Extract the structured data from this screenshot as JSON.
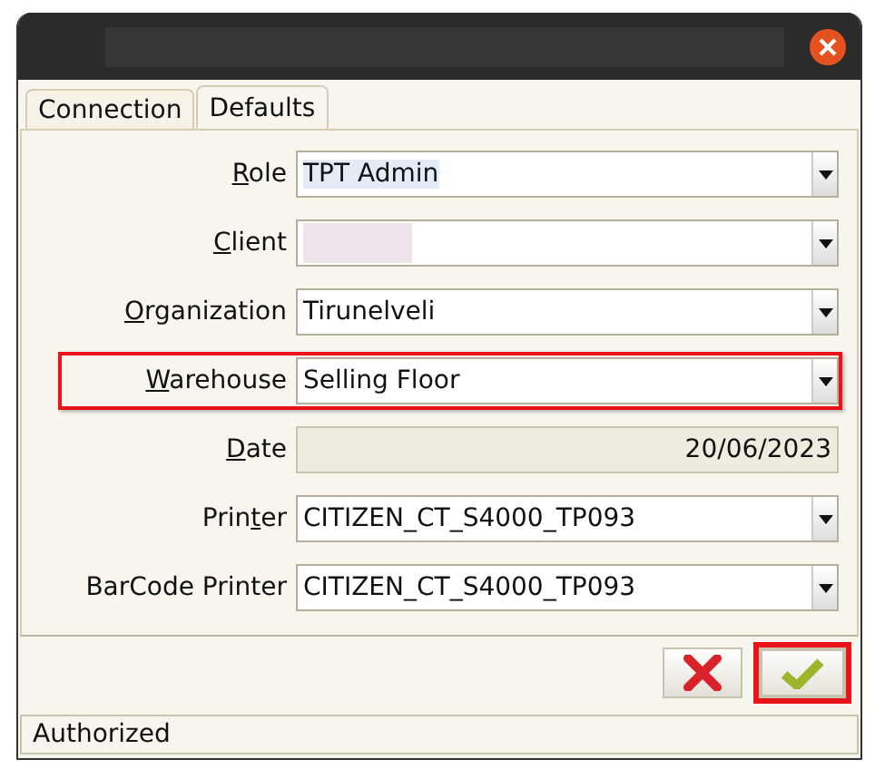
{
  "tabs": [
    {
      "label": "Connection",
      "selected": false
    },
    {
      "label": "Defaults",
      "selected": true
    }
  ],
  "fields": [
    {
      "label": {
        "key": "R",
        "post": "ole"
      },
      "kind": "combo",
      "value": "TPT Admin",
      "text_selected": true,
      "highlighted": false
    },
    {
      "label": {
        "key": "C",
        "post": "lient"
      },
      "kind": "combo",
      "redacted": true,
      "highlighted": false
    },
    {
      "label": {
        "key": "O",
        "post": "rganization"
      },
      "kind": "combo",
      "value": "Tirunelveli",
      "text_selected": false,
      "highlighted": false
    },
    {
      "label": {
        "key": "W",
        "post": "arehouse"
      },
      "kind": "combo",
      "value": "Selling Floor",
      "text_selected": false,
      "highlighted": true
    },
    {
      "label": {
        "key": "D",
        "post": "ate"
      },
      "kind": "date",
      "value": "20/06/2023",
      "highlighted": false
    },
    {
      "label": {
        "pre": "Prin",
        "key": "t",
        "post": "er"
      },
      "kind": "combo",
      "value": "CITIZEN_CT_S4000_TP093",
      "text_selected": false,
      "highlighted": false
    },
    {
      "label": {
        "pre": "BarCode Printer"
      },
      "kind": "combo",
      "value": "CITIZEN_CT_S4000_TP093",
      "text_selected": false,
      "highlighted": false
    }
  ],
  "buttons": [
    {
      "kind": "cancel",
      "highlighted": false
    },
    {
      "kind": "ok",
      "highlighted": true
    }
  ],
  "status_bar": "Authorized"
}
